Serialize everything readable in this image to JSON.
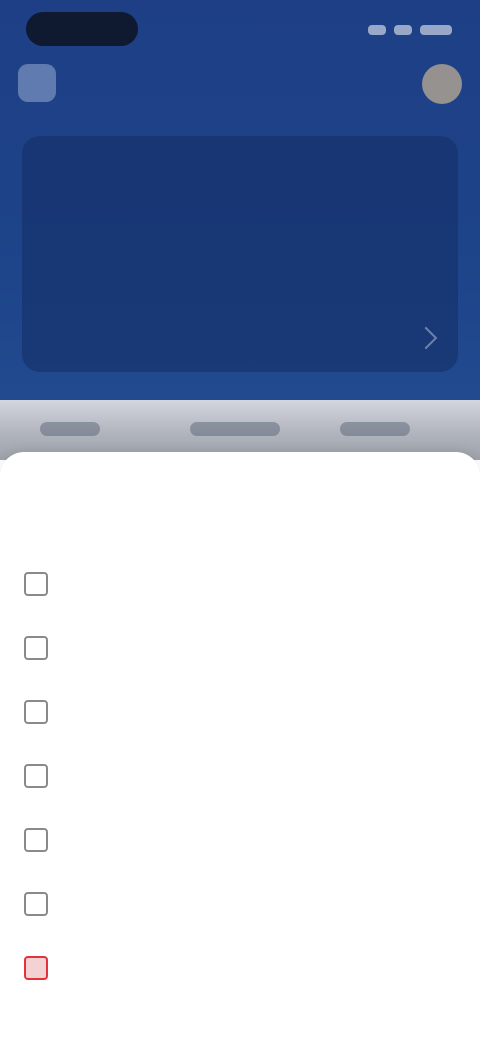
{
  "status_bar": {},
  "header": {},
  "balance_card": {
    "label": "",
    "amount": "",
    "sub": "",
    "footer": ""
  },
  "sheet": {
    "title": "",
    "items": [
      {
        "icon": "document-icon",
        "label": ""
      },
      {
        "icon": "card-icon",
        "label": ""
      },
      {
        "icon": "transfer-icon",
        "label": ""
      },
      {
        "icon": "bank-icon",
        "label": ""
      },
      {
        "icon": "settings-icon",
        "label": ""
      },
      {
        "icon": "help-icon",
        "label": ""
      },
      {
        "icon": "close-icon",
        "label": "",
        "danger": true
      }
    ]
  },
  "colors": {
    "header_bg": "#1e3f86",
    "danger": "#e0333a"
  }
}
